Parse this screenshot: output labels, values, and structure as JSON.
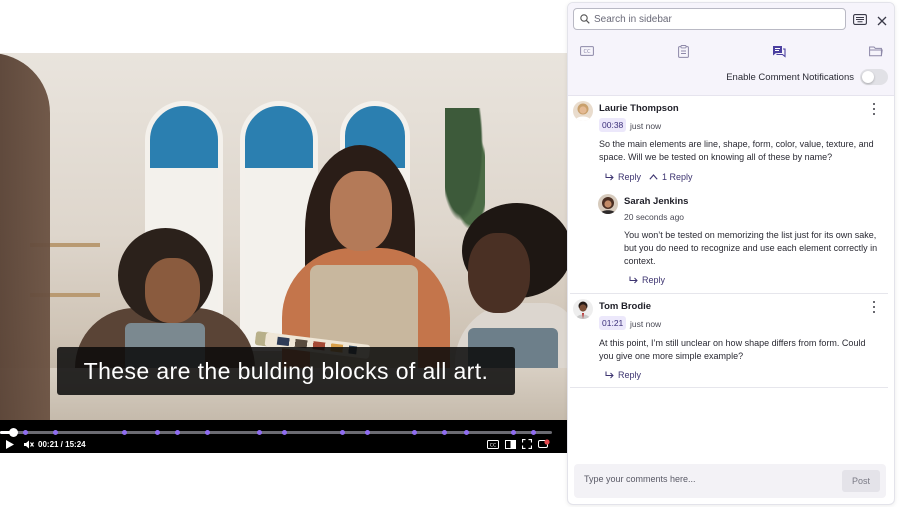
{
  "video": {
    "caption": "These are the bulding blocks of all art.",
    "time_display": "00:21 / 15:24",
    "progress_fraction": 0.023,
    "comment_marker_fractions": [
      0.045,
      0.1,
      0.225,
      0.285,
      0.32,
      0.375,
      0.47,
      0.515,
      0.62,
      0.665,
      0.75,
      0.805,
      0.845,
      0.93,
      0.965
    ],
    "colors": {
      "marker": "#8f6cf0",
      "control_bar": "#000000"
    }
  },
  "sidebar": {
    "search": {
      "placeholder": "Search in sidebar"
    },
    "tabs": [
      {
        "name": "captions",
        "icon": "cc-icon"
      },
      {
        "name": "notes",
        "icon": "notes-icon"
      },
      {
        "name": "comments",
        "icon": "comments-icon",
        "active": true
      },
      {
        "name": "files",
        "icon": "folder-icon"
      }
    ],
    "notifications": {
      "label": "Enable Comment Notifications",
      "enabled": false
    },
    "comments": [
      {
        "author": "Laurie Thompson",
        "timestamp": "00:38",
        "relative_time": "just now",
        "text": "So the main elements are line, shape, form, color, value, texture, and space. Will we be tested on knowing all of these by name?",
        "reply_label": "Reply",
        "replies_toggle": "1 Reply",
        "replies": [
          {
            "author": "Sarah Jenkins",
            "relative_time": "20 seconds ago",
            "text": "You won’t be tested on memorizing the list just for its own sake, but you do need to recognize and use each element correctly in context.",
            "reply_label": "Reply"
          }
        ]
      },
      {
        "author": "Tom Brodie",
        "timestamp": "01:21",
        "relative_time": "just now",
        "text": "At this point, I’m still unclear on how shape differs from form. Could you give one more simple example?",
        "reply_label": "Reply"
      }
    ],
    "composer": {
      "placeholder": "Type your comments here...",
      "post_label": "Post"
    },
    "colors": {
      "accent": "#4b3fa0",
      "badge_bg": "#ece8fb",
      "header_bg": "#f6f4fb"
    }
  }
}
